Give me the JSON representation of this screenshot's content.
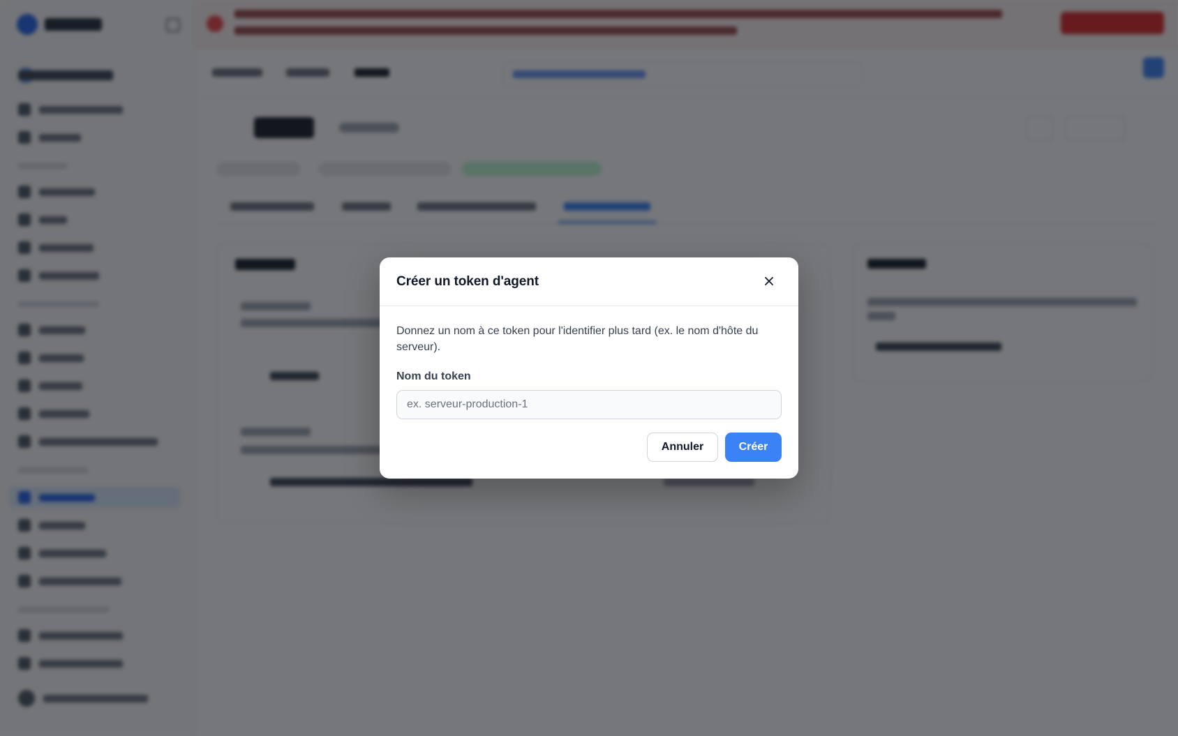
{
  "dialog": {
    "title": "Créer un token d'agent",
    "close_icon": "close-icon",
    "description": "Donnez un nom à ce token pour l'identifier plus tard (ex. le nom d'hôte du serveur).",
    "field_label": "Nom du token",
    "input_value": "",
    "input_placeholder": "ex. serveur-production-1",
    "cancel_label": "Annuler",
    "create_label": "Créer"
  },
  "colors": {
    "primary": "#3b82f6",
    "overlay": "rgba(17,20,26,0.58)",
    "danger": "#dc2626"
  }
}
